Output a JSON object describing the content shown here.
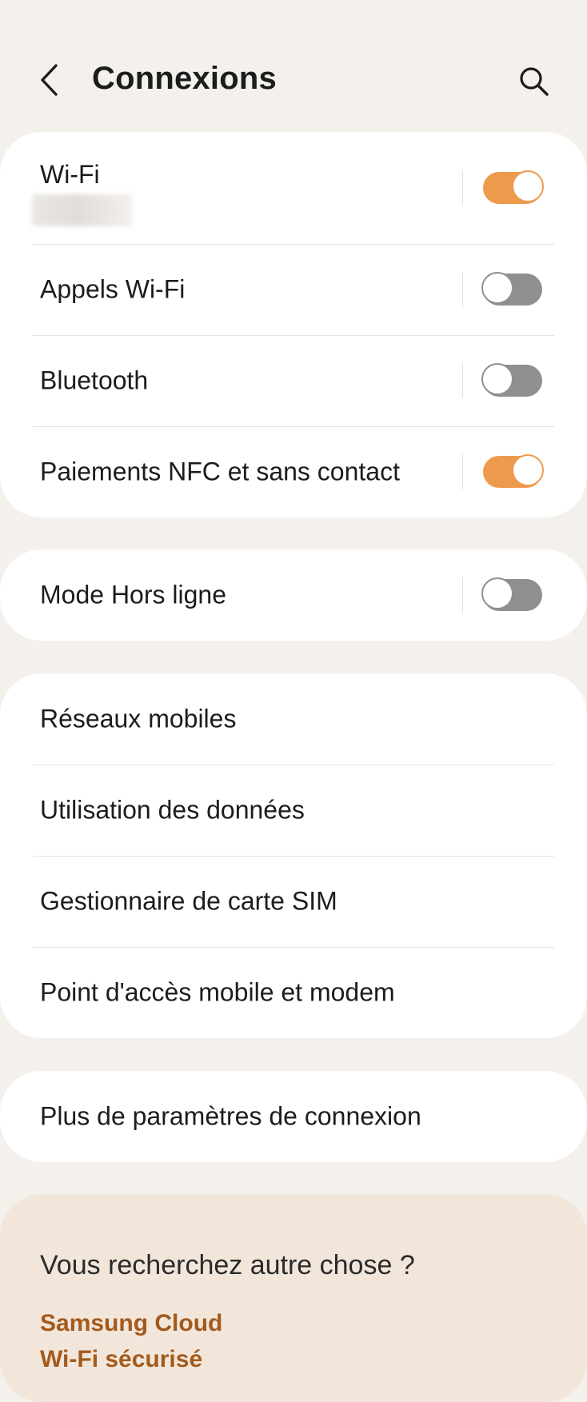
{
  "header": {
    "title": "Connexions",
    "back_icon": "chevron-left-icon",
    "search_icon": "search-icon"
  },
  "colors": {
    "background": "#f4f1ec",
    "card": "#ffffff",
    "toggle_on": "#ee9a4d",
    "toggle_off": "#8f8f8f",
    "suggest_bg": "#f2e6db",
    "link": "#a35a1d"
  },
  "groups": {
    "toggles": [
      {
        "label": "Wi-Fi",
        "enabled": true
      },
      {
        "label": "Appels Wi-Fi",
        "enabled": false
      },
      {
        "label": "Bluetooth",
        "enabled": false
      },
      {
        "label": "Paiements NFC et sans contact",
        "enabled": true
      }
    ],
    "airplane": {
      "label": "Mode Hors ligne",
      "enabled": false
    },
    "network": [
      {
        "label": "Réseaux mobiles"
      },
      {
        "label": "Utilisation des données"
      },
      {
        "label": "Gestionnaire de carte SIM"
      },
      {
        "label": "Point d'accès mobile et modem"
      }
    ],
    "more": {
      "label": "Plus de paramètres de connexion"
    }
  },
  "suggestions": {
    "title": "Vous recherchez autre chose ?",
    "links": [
      "Samsung Cloud",
      "Wi-Fi sécurisé"
    ]
  }
}
